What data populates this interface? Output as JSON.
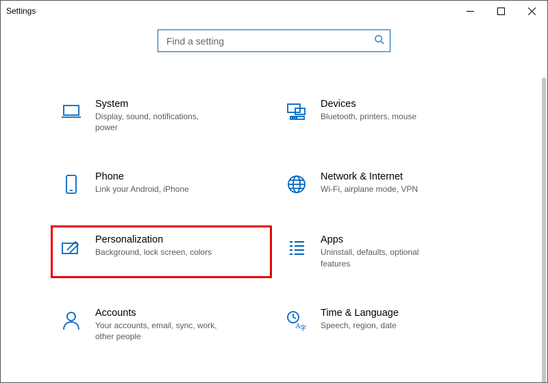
{
  "window": {
    "title": "Settings"
  },
  "search": {
    "placeholder": "Find a setting"
  },
  "categories": [
    {
      "id": "system",
      "title": "System",
      "desc": "Display, sound, notifications, power"
    },
    {
      "id": "devices",
      "title": "Devices",
      "desc": "Bluetooth, printers, mouse"
    },
    {
      "id": "phone",
      "title": "Phone",
      "desc": "Link your Android, iPhone"
    },
    {
      "id": "network",
      "title": "Network & Internet",
      "desc": "Wi-Fi, airplane mode, VPN"
    },
    {
      "id": "personalization",
      "title": "Personalization",
      "desc": "Background, lock screen, colors"
    },
    {
      "id": "apps",
      "title": "Apps",
      "desc": "Uninstall, defaults, optional features"
    },
    {
      "id": "accounts",
      "title": "Accounts",
      "desc": "Your accounts, email, sync, work, other people"
    },
    {
      "id": "time",
      "title": "Time & Language",
      "desc": "Speech, region, date"
    }
  ],
  "highlighted": "personalization",
  "colors": {
    "accent": "#0067c0",
    "highlight": "#e60000"
  }
}
